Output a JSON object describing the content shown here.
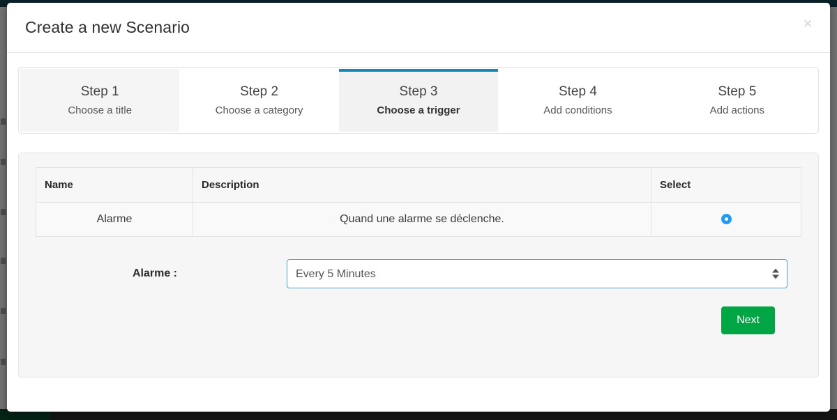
{
  "modal": {
    "title": "Create a new Scenario",
    "close_icon": "close-icon",
    "close_label": "×"
  },
  "steps": [
    {
      "title": "Step 1",
      "subtitle": "Choose a title",
      "state": "done"
    },
    {
      "title": "Step 2",
      "subtitle": "Choose a category",
      "state": "upcoming"
    },
    {
      "title": "Step 3",
      "subtitle": "Choose a trigger",
      "state": "active"
    },
    {
      "title": "Step 4",
      "subtitle": "Add conditions",
      "state": "upcoming"
    },
    {
      "title": "Step 5",
      "subtitle": "Add actions",
      "state": "upcoming"
    }
  ],
  "table": {
    "headers": [
      "Name",
      "Description",
      "Select"
    ],
    "rows": [
      {
        "name": "Alarme",
        "description": "Quand une alarme se déclenche.",
        "selected": true
      }
    ]
  },
  "trigger_select": {
    "label": "Alarme :",
    "value": "Every 5 Minutes",
    "options": [
      "Every 5 Minutes"
    ]
  },
  "footer": {
    "next_label": "Next"
  },
  "colors": {
    "active_step_bar": "#1586b8",
    "radio_selected": "#1d9bf6",
    "next_button": "#00a544",
    "select_focus_border": "#4ba3cd",
    "backdrop_topbar": "#184a5e"
  }
}
